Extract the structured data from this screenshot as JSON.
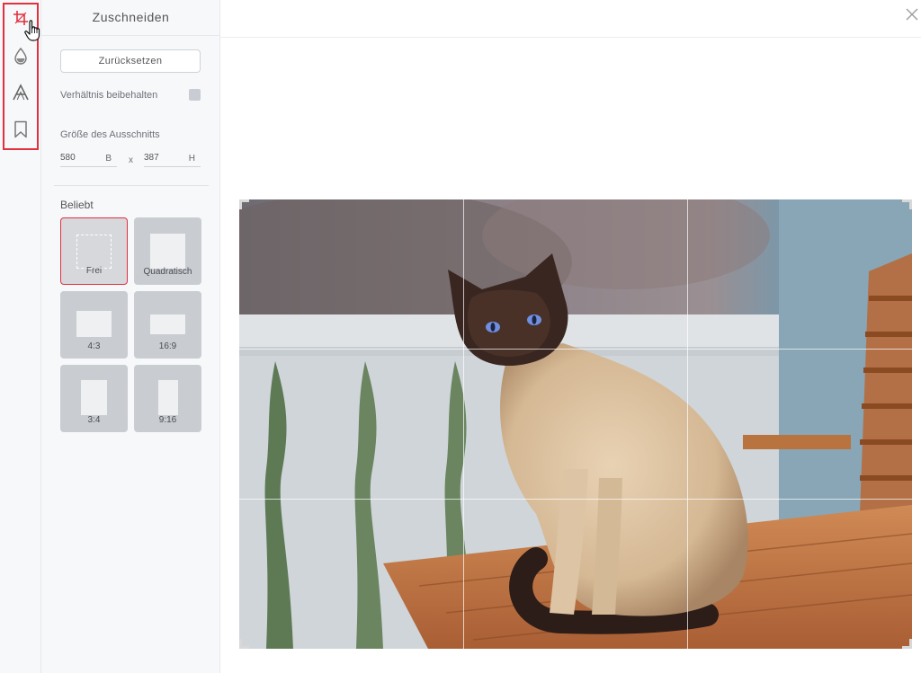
{
  "rail": {
    "tools": [
      {
        "name": "crop",
        "icon": "crop-icon",
        "active": true
      },
      {
        "name": "adjust",
        "icon": "drop-icon"
      },
      {
        "name": "text",
        "icon": "text-a-icon"
      },
      {
        "name": "bookmark",
        "icon": "bookmark-icon"
      }
    ],
    "highlight_color": "#e3303f"
  },
  "panel": {
    "title": "Zuschneiden",
    "reset_label": "Zurücksetzen",
    "keep_ratio_label": "Verhältnis beibehalten",
    "size_label": "Größe des Ausschnitts",
    "width_value": "580",
    "width_unit": "B",
    "separator": "x",
    "height_value": "387",
    "height_unit": "H",
    "popular_label": "Beliebt",
    "ratios": [
      {
        "label": "Frei",
        "active": true
      },
      {
        "label": "Quadratisch"
      },
      {
        "label": "4:3"
      },
      {
        "label": "16:9"
      },
      {
        "label": "3:4"
      },
      {
        "label": "9:16"
      }
    ]
  },
  "main": {
    "close_icon": "close-icon",
    "image_subject": "Siamese cat sitting on a wooden table on a balcony"
  },
  "colors": {
    "accent": "#e3303f",
    "panel_bg": "#f7f8fa"
  }
}
